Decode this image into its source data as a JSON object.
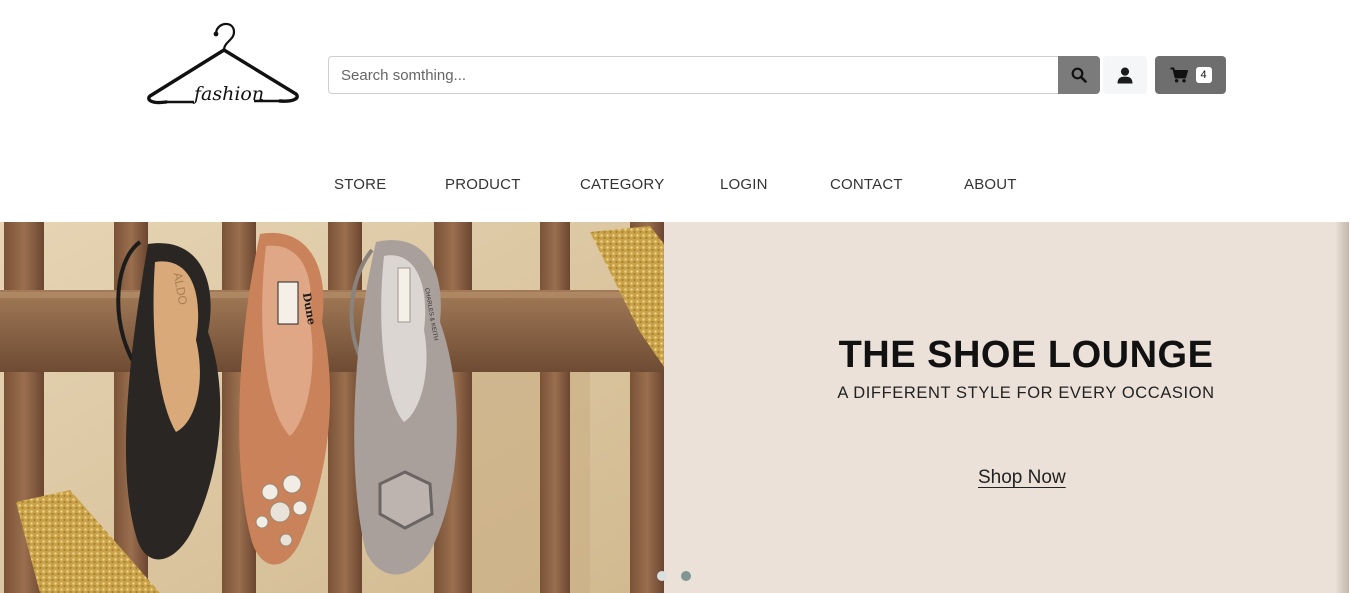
{
  "brand": {
    "logo_text": "fashion"
  },
  "search": {
    "placeholder": "Search somthing..."
  },
  "cart": {
    "count": "4"
  },
  "nav": {
    "items": [
      {
        "label": "STORE"
      },
      {
        "label": "PRODUCT"
      },
      {
        "label": "CATEGORY"
      },
      {
        "label": "LOGIN"
      },
      {
        "label": "CONTACT"
      },
      {
        "label": "ABOUT"
      }
    ]
  },
  "hero": {
    "title": "THE SHOE LOUNGE",
    "subtitle": "A DIFFERENT STYLE FOR EVERY OCCASION",
    "cta": "Shop Now",
    "shoe_brands": [
      "ALDO",
      "Dune",
      "CHARLES & KEITH"
    ],
    "slides": {
      "count": 2,
      "active": 2
    }
  },
  "colors": {
    "hero_bg": "#ebe1d9",
    "search_button": "#7b7b7b",
    "cart_button": "#6e6e6e",
    "dot_inactive": "#d9e0df",
    "dot_active": "#7f9692"
  },
  "icons": {
    "search": "search-icon",
    "user": "user-icon",
    "cart": "cart-icon",
    "logo": "hanger-logo"
  }
}
